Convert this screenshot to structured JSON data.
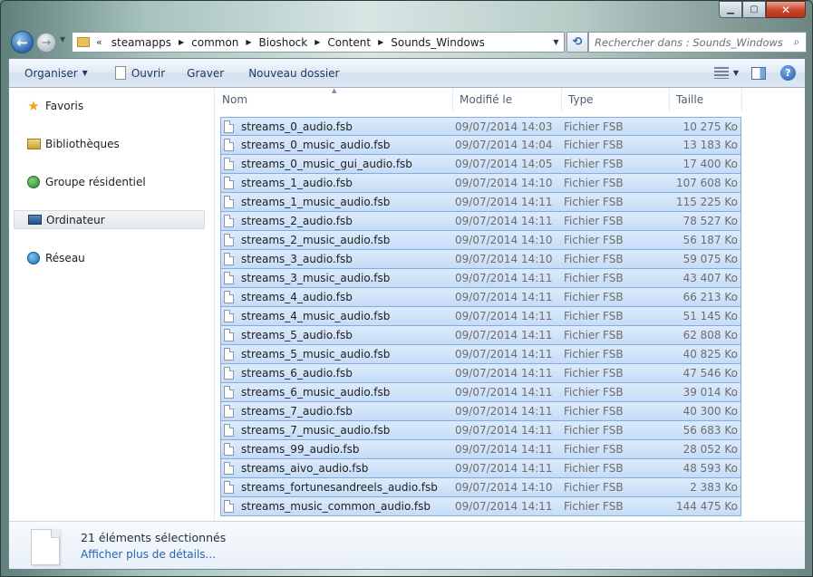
{
  "window": {
    "caption_buttons": [
      "minimize",
      "maximize",
      "close"
    ]
  },
  "nav": {
    "breadcrumbs": [
      {
        "label": "steamapps"
      },
      {
        "label": "common"
      },
      {
        "label": "Bioshock"
      },
      {
        "label": "Content"
      },
      {
        "label": "Sounds_Windows"
      }
    ],
    "overflow_chevron": "«",
    "search_placeholder": "Rechercher dans : Sounds_Windows"
  },
  "toolbar": {
    "organize_label": "Organiser",
    "open_label": "Ouvrir",
    "burn_label": "Graver",
    "new_folder_label": "Nouveau dossier",
    "help_label": "?"
  },
  "sidebar": {
    "items": [
      {
        "label": "Favoris",
        "icon": "star-icon"
      },
      {
        "label": "Bibliothèques",
        "icon": "libraries-icon"
      },
      {
        "label": "Groupe résidentiel",
        "icon": "homegroup-icon"
      },
      {
        "label": "Ordinateur",
        "icon": "computer-icon",
        "selected": true
      },
      {
        "label": "Réseau",
        "icon": "network-icon"
      }
    ]
  },
  "columns": {
    "name": "Nom",
    "modified": "Modifié le",
    "type": "Type",
    "size": "Taille"
  },
  "files": [
    {
      "name": "streams_0_audio.fsb",
      "date": "09/07/2014 14:03",
      "type": "Fichier FSB",
      "size": "10 275 Ko"
    },
    {
      "name": "streams_0_music_audio.fsb",
      "date": "09/07/2014 14:04",
      "type": "Fichier FSB",
      "size": "13 183 Ko"
    },
    {
      "name": "streams_0_music_gui_audio.fsb",
      "date": "09/07/2014 14:05",
      "type": "Fichier FSB",
      "size": "17 400 Ko"
    },
    {
      "name": "streams_1_audio.fsb",
      "date": "09/07/2014 14:10",
      "type": "Fichier FSB",
      "size": "107 608 Ko"
    },
    {
      "name": "streams_1_music_audio.fsb",
      "date": "09/07/2014 14:11",
      "type": "Fichier FSB",
      "size": "115 225 Ko"
    },
    {
      "name": "streams_2_audio.fsb",
      "date": "09/07/2014 14:11",
      "type": "Fichier FSB",
      "size": "78 527 Ko"
    },
    {
      "name": "streams_2_music_audio.fsb",
      "date": "09/07/2014 14:10",
      "type": "Fichier FSB",
      "size": "56 187 Ko"
    },
    {
      "name": "streams_3_audio.fsb",
      "date": "09/07/2014 14:10",
      "type": "Fichier FSB",
      "size": "59 075 Ko"
    },
    {
      "name": "streams_3_music_audio.fsb",
      "date": "09/07/2014 14:11",
      "type": "Fichier FSB",
      "size": "43 407 Ko"
    },
    {
      "name": "streams_4_audio.fsb",
      "date": "09/07/2014 14:11",
      "type": "Fichier FSB",
      "size": "66 213 Ko"
    },
    {
      "name": "streams_4_music_audio.fsb",
      "date": "09/07/2014 14:11",
      "type": "Fichier FSB",
      "size": "51 145 Ko"
    },
    {
      "name": "streams_5_audio.fsb",
      "date": "09/07/2014 14:11",
      "type": "Fichier FSB",
      "size": "62 808 Ko"
    },
    {
      "name": "streams_5_music_audio.fsb",
      "date": "09/07/2014 14:11",
      "type": "Fichier FSB",
      "size": "40 825 Ko"
    },
    {
      "name": "streams_6_audio.fsb",
      "date": "09/07/2014 14:11",
      "type": "Fichier FSB",
      "size": "47 546 Ko"
    },
    {
      "name": "streams_6_music_audio.fsb",
      "date": "09/07/2014 14:11",
      "type": "Fichier FSB",
      "size": "39 014 Ko"
    },
    {
      "name": "streams_7_audio.fsb",
      "date": "09/07/2014 14:11",
      "type": "Fichier FSB",
      "size": "40 300 Ko"
    },
    {
      "name": "streams_7_music_audio.fsb",
      "date": "09/07/2014 14:11",
      "type": "Fichier FSB",
      "size": "56 683 Ko"
    },
    {
      "name": "streams_99_audio.fsb",
      "date": "09/07/2014 14:11",
      "type": "Fichier FSB",
      "size": "28 052 Ko"
    },
    {
      "name": "streams_aivo_audio.fsb",
      "date": "09/07/2014 14:11",
      "type": "Fichier FSB",
      "size": "48 593 Ko"
    },
    {
      "name": "streams_fortunesandreels_audio.fsb",
      "date": "09/07/2014 14:10",
      "type": "Fichier FSB",
      "size": "2 383 Ko"
    },
    {
      "name": "streams_music_common_audio.fsb",
      "date": "09/07/2014 14:11",
      "type": "Fichier FSB",
      "size": "144 475 Ko"
    }
  ],
  "details": {
    "selection_count": "21 éléments sélectionnés",
    "more_details_link": "Afficher plus de détails..."
  },
  "colors": {
    "selection_fill": "#c5dcf6",
    "selection_border": "#84acdd",
    "link": "#2066b5"
  }
}
